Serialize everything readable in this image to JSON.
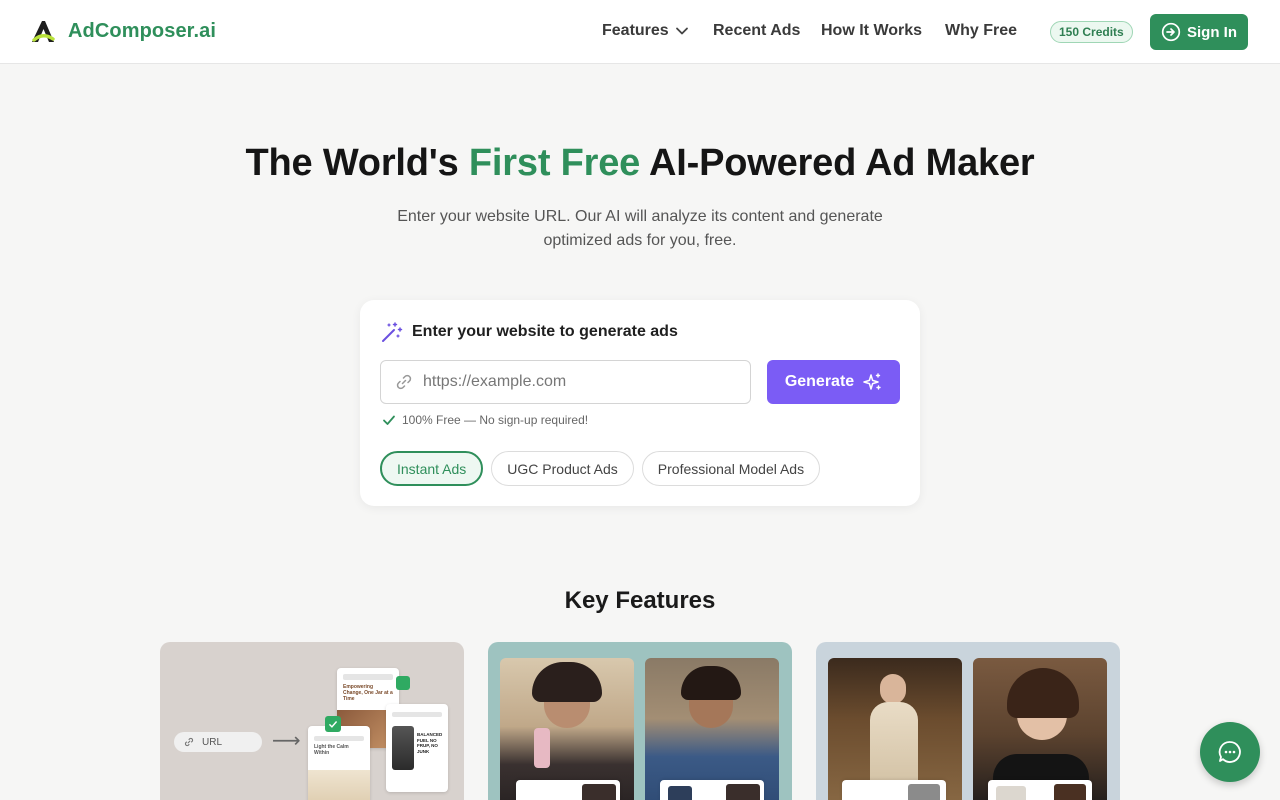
{
  "header": {
    "logo_text": "AdComposer.ai",
    "nav": {
      "features": "Features",
      "recent_ads": "Recent Ads",
      "how_it_works": "How It Works",
      "why_free": "Why Free"
    },
    "credits": "150 Credits",
    "sign_in": "Sign In"
  },
  "hero": {
    "title_start": "The World's ",
    "title_accent": "First Free",
    "title_end": " AI-Powered Ad Maker",
    "subtitle": "Enter your website URL. Our AI will analyze its content and generate optimized ads for you, free."
  },
  "generator": {
    "title": "Enter your website to generate ads",
    "url_placeholder": "https://example.com",
    "generate_label": "Generate",
    "free_note": "100% Free — No sign-up required!",
    "modes": [
      "Instant Ads",
      "UGC Product Ads",
      "Professional Model Ads"
    ],
    "active_mode": "Instant Ads"
  },
  "features": {
    "title": "Key Features",
    "card1": {
      "url_label": "URL",
      "ad1_text": "Empowering Change, One Jar at a Time",
      "ad2_text": "Light the Calm Within",
      "ad3_text": "BALANCED FUEL NO FRUP, NO JUNK"
    }
  },
  "colors": {
    "brand": "#2f8f5b",
    "generate": "#7b5cf5",
    "background": "#f6f6f5"
  }
}
